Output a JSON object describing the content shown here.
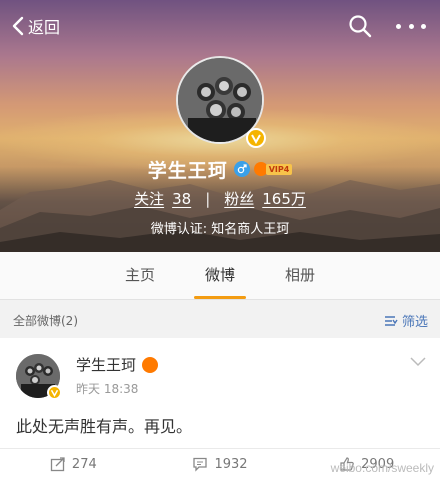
{
  "topbar": {
    "back_label": "返回"
  },
  "profile": {
    "name": "学生王珂",
    "vip_label": "VIP4",
    "follow_label": "关注",
    "follow_count": "38",
    "fans_label": "粉丝",
    "fans_count": "165万",
    "verify_text": "微博认证: 知名商人王珂"
  },
  "tabs": [
    {
      "label": "主页"
    },
    {
      "label": "微博"
    },
    {
      "label": "相册"
    }
  ],
  "active_tab": "微博",
  "filter": {
    "count_label": "全部微博(2)",
    "filter_label": "筛选"
  },
  "post": {
    "author": "学生王珂",
    "time": "昨天 18:38",
    "text": "此处无声胜有声。再见。",
    "reposts": "274",
    "comments": "1932",
    "likes": "2909"
  },
  "watermark": "weibo.com/sweekly",
  "colors": {
    "accent": "#f39c12",
    "link": "#4a76b8",
    "verify": "#f5b400",
    "gender": "#3aa0e8"
  }
}
